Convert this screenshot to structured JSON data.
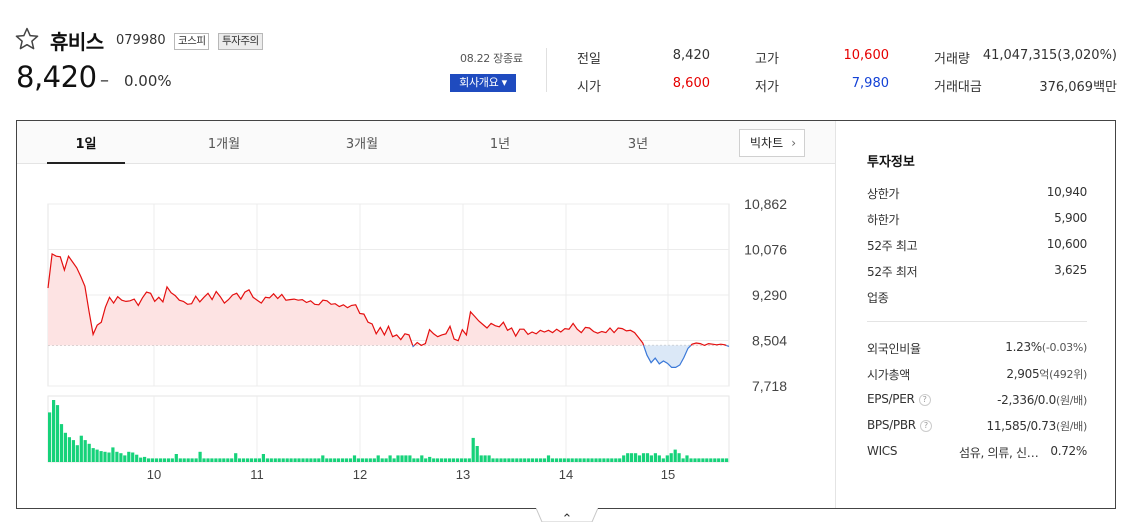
{
  "stock": {
    "name": "휴비스",
    "code": "079980",
    "market_tag": "코스피",
    "warning_tag": "투자주의",
    "price": "8,420",
    "change_sign": "–",
    "change_pct": "0.00%",
    "date_label": "08.22 장종료",
    "company_button": "회사개요 ▾"
  },
  "quote": {
    "prev_label": "전일",
    "prev_value": "8,420",
    "open_label": "시가",
    "open_value": "8,600",
    "high_label": "고가",
    "high_value": "10,600",
    "low_label": "저가",
    "low_value": "7,980",
    "volume_label": "거래량",
    "volume_value": "41,047,315(3,020%)",
    "amount_label": "거래대금",
    "amount_value": "376,069백만"
  },
  "tabs": [
    {
      "label": "1일",
      "active": true
    },
    {
      "label": "1개월",
      "active": false
    },
    {
      "label": "3개월",
      "active": false
    },
    {
      "label": "1년",
      "active": false
    },
    {
      "label": "3년",
      "active": false
    }
  ],
  "big_chart_button": "빅차트",
  "colors": {
    "up": "#e60000",
    "down": "#1442d6",
    "line_up": "#e41010",
    "fill_up": "#fde3e3",
    "line_down": "#3a78d8",
    "fill_down": "#dbe8f7",
    "volume": "#16d27a",
    "button_blue": "#1f4bbf"
  },
  "chart_data": {
    "type": "line",
    "x_ticks": [
      "10",
      "11",
      "12",
      "13",
      "14",
      "15"
    ],
    "y_ticks": [
      "10,862",
      "10,076",
      "9,290",
      "8,504",
      "7,718"
    ],
    "ylim": [
      7718,
      10862
    ],
    "baseline": 8420,
    "price_series": [
      9410,
      10000,
      9960,
      9950,
      9720,
      9960,
      9860,
      9760,
      9610,
      9440,
      9010,
      8610,
      8770,
      8820,
      9080,
      9250,
      9150,
      9260,
      9200,
      9180,
      9190,
      9220,
      9110,
      9240,
      9340,
      9320,
      9180,
      9250,
      9170,
      9430,
      9330,
      9280,
      9200,
      9180,
      9130,
      9140,
      9270,
      9170,
      9250,
      9320,
      9210,
      9350,
      9260,
      9150,
      9210,
      9290,
      9320,
      9220,
      9340,
      9380,
      9250,
      9200,
      9150,
      9250,
      9240,
      9310,
      9230,
      9300,
      9200,
      9210,
      9220,
      9200,
      9210,
      9160,
      9190,
      9130,
      9120,
      9200,
      9190,
      9130,
      9140,
      9090,
      9120,
      9070,
      9110,
      9120,
      8970,
      8960,
      8820,
      8790,
      8620,
      8730,
      8600,
      8750,
      8570,
      8600,
      8520,
      8620,
      8600,
      8400,
      8470,
      8420,
      8450,
      8690,
      8620,
      8570,
      8600,
      8620,
      8750,
      8530,
      8500,
      8690,
      8600,
      9000,
      8920,
      8840,
      8780,
      8720,
      8800,
      8760,
      8740,
      8820,
      8680,
      8720,
      8580,
      8700,
      8700,
      8610,
      8650,
      8620,
      8680,
      8650,
      8680,
      8640,
      8700,
      8650,
      8710,
      8700,
      8800,
      8700,
      8640,
      8730,
      8720,
      8660,
      8630,
      8660,
      8640,
      8720,
      8640,
      8720,
      8710,
      8670,
      8680,
      8640,
      8550,
      8460,
      8250,
      8120,
      8200,
      8100,
      8150,
      8110,
      8040,
      8040,
      8080,
      8210,
      8370,
      8440,
      8460,
      8450,
      8420,
      8450,
      8440,
      8430,
      8440,
      8430,
      8400
    ],
    "volume_series": [
      68,
      85,
      78,
      52,
      40,
      34,
      30,
      23,
      36,
      30,
      25,
      19,
      17,
      15,
      14,
      13,
      20,
      14,
      12,
      9,
      14,
      13,
      10,
      6,
      7,
      5,
      5,
      5,
      5,
      5,
      5,
      5,
      11,
      5,
      5,
      5,
      5,
      5,
      14,
      5,
      5,
      5,
      5,
      5,
      5,
      5,
      5,
      12,
      5,
      5,
      5,
      5,
      5,
      5,
      11,
      5,
      5,
      5,
      5,
      5,
      5,
      5,
      5,
      5,
      5,
      5,
      5,
      5,
      5,
      9,
      5,
      5,
      5,
      5,
      5,
      5,
      5,
      9,
      5,
      5,
      5,
      5,
      5,
      9,
      5,
      5,
      9,
      5,
      9,
      9,
      9,
      9,
      5,
      5,
      9,
      5,
      7,
      5,
      5,
      5,
      5,
      5,
      5,
      5,
      5,
      5,
      5,
      33,
      22,
      9,
      9,
      9,
      5,
      5,
      5,
      5,
      5,
      5,
      5,
      5,
      5,
      5,
      5,
      5,
      5,
      5,
      9,
      5,
      5,
      5,
      5,
      5,
      5,
      5,
      5,
      5,
      5,
      5,
      5,
      5,
      5,
      5,
      5,
      5,
      5,
      9,
      12,
      12,
      12,
      9,
      12,
      12,
      9,
      12,
      9,
      5,
      9,
      12,
      17,
      12,
      5,
      9,
      5,
      5,
      5,
      5,
      5,
      5,
      5,
      5,
      5,
      5
    ]
  },
  "info": {
    "title": "투자정보",
    "upper_label": "상한가",
    "upper_value": "10,940",
    "lower_label": "하한가",
    "lower_value": "5,900",
    "high52_label": "52주 최고",
    "high52_value": "10,600",
    "low52_label": "52주 최저",
    "low52_value": "3,625",
    "sector_label": "업종",
    "foreign_label": "외국인비율",
    "foreign_value": "1.23%",
    "foreign_change": "(-0.03%)",
    "cap_label": "시가총액",
    "cap_value": "2,905",
    "cap_unit": "억(492위)",
    "eps_label": "EPS/PER",
    "eps_value": "-2,336/0.0",
    "eps_unit": "(원/배)",
    "bps_label": "BPS/PBR",
    "bps_value": "11,585/0.73",
    "bps_unit": "(원/배)",
    "wics_label": "WICS",
    "wics_value": "섬유, 의류, 신…",
    "wics_change": "0.72%",
    "help_glyph": "?"
  },
  "collapse_glyph": "⌃"
}
